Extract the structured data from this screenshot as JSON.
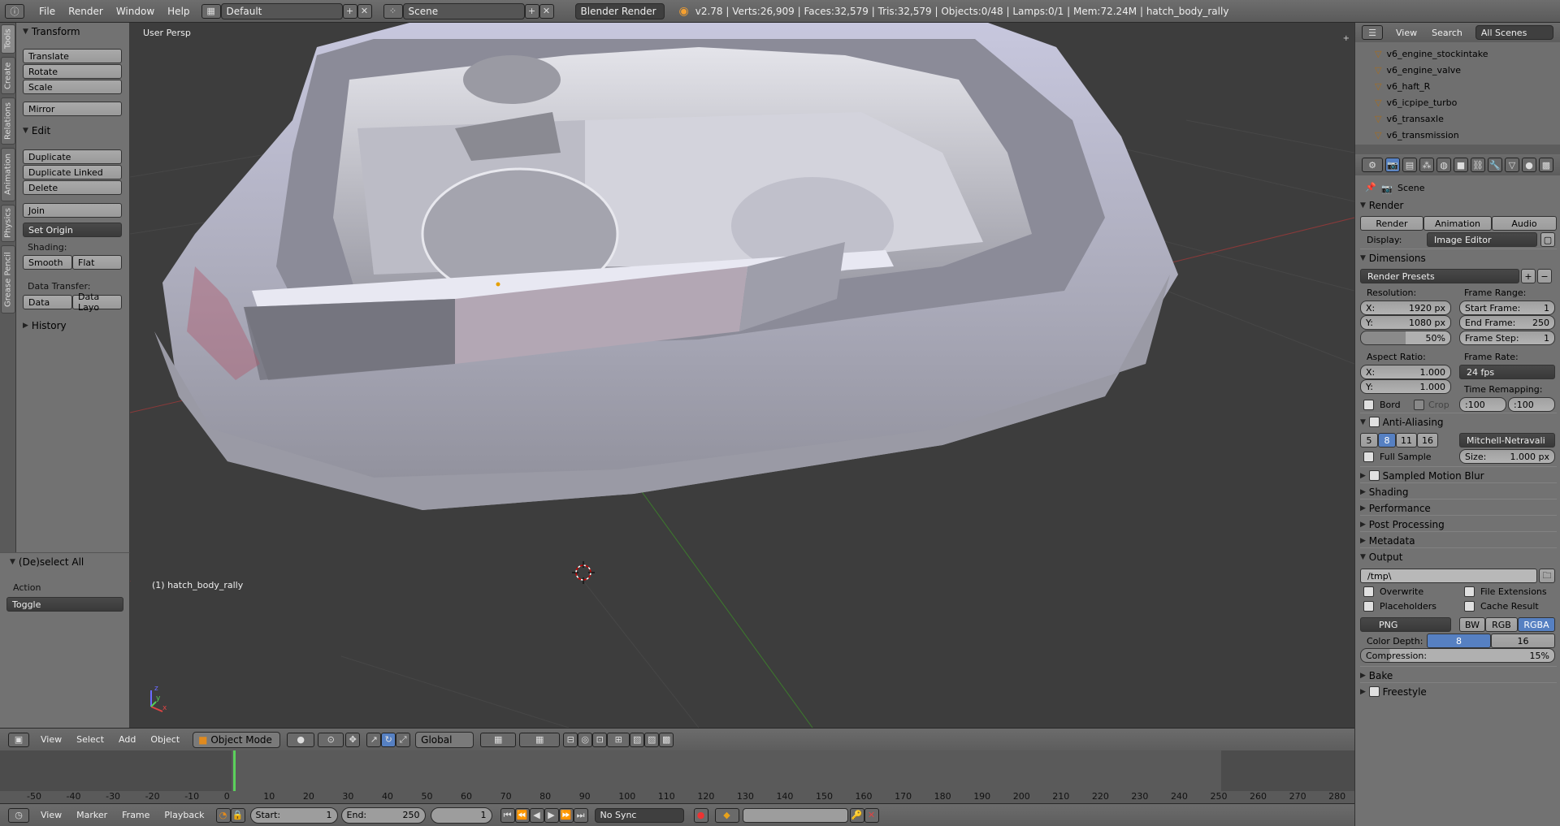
{
  "topbar": {
    "menus": [
      "File",
      "Render",
      "Window",
      "Help"
    ],
    "layout": "Default",
    "scene": "Scene",
    "engine": "Blender Render",
    "stats": "v2.78 | Verts:26,909 | Faces:32,579 | Tris:32,579 | Objects:0/48 | Lamps:0/1 | Mem:72.24M | hatch_body_rally"
  },
  "vtabs": [
    "Tools",
    "Create",
    "Relations",
    "Animation",
    "Physics",
    "Grease Pencil"
  ],
  "tools": {
    "transform_title": "Transform",
    "translate": "Translate",
    "rotate": "Rotate",
    "scale": "Scale",
    "mirror": "Mirror",
    "edit_title": "Edit",
    "duplicate": "Duplicate",
    "duplicate_linked": "Duplicate Linked",
    "delete": "Delete",
    "join": "Join",
    "set_origin": "Set Origin",
    "shading_label": "Shading:",
    "smooth": "Smooth",
    "flat": "Flat",
    "data_transfer_label": "Data Transfer:",
    "data": "Data",
    "data_layout": "Data Layo",
    "history_title": "History"
  },
  "operator": {
    "title": "(De)select All",
    "action_label": "Action",
    "action_value": "Toggle"
  },
  "viewport": {
    "view_name": "User Persp",
    "object_label": "(1) hatch_body_rally"
  },
  "outliner": {
    "menu_view": "View",
    "menu_search": "Search",
    "filter": "All Scenes",
    "items": [
      "v6_engine_stockintake",
      "v6_engine_valve",
      "v6_haft_R",
      "v6_icpipe_turbo",
      "v6_transaxle",
      "v6_transmission"
    ]
  },
  "props": {
    "scene": "Scene",
    "render_title": "Render",
    "render_btn": "Render",
    "animation_btn": "Animation",
    "audio_btn": "Audio",
    "display_label": "Display:",
    "display_value": "Image Editor",
    "dimensions_title": "Dimensions",
    "render_presets": "Render Presets",
    "resolution_label": "Resolution:",
    "res_x": "1920 px",
    "res_y": "1080 px",
    "res_pct": "50%",
    "frame_range_label": "Frame Range:",
    "start_frame": "1",
    "end_frame": "250",
    "frame_step": "1",
    "start_frame_label": "Start Frame:",
    "end_frame_label": "End Frame:",
    "frame_step_label": "Frame Step:",
    "aspect_label": "Aspect Ratio:",
    "aspect_x": "1.000",
    "aspect_y": "1.000",
    "frame_rate_label": "Frame Rate:",
    "frame_rate": "24 fps",
    "time_remap_label": "Time Remapping:",
    "remap_old": ":100",
    "remap_new": ":100",
    "bord": "Bord",
    "crop": "Crop",
    "aa_title": "Anti-Aliasing",
    "aa_samples": [
      "5",
      "8",
      "11",
      "16"
    ],
    "aa_filter": "Mitchell-Netravali",
    "full_sample": "Full Sample",
    "size_label": "Size:",
    "size_value": "1.000 px",
    "smb_title": "Sampled Motion Blur",
    "shading_title": "Shading",
    "performance_title": "Performance",
    "post_title": "Post Processing",
    "metadata_title": "Metadata",
    "output_title": "Output",
    "output_path": "/tmp\\",
    "overwrite": "Overwrite",
    "file_ext": "File Extensions",
    "placeholders": "Placeholders",
    "cache_result": "Cache Result",
    "format": "PNG",
    "bw": "BW",
    "rgb": "RGB",
    "rgba": "RGBA",
    "color_depth_label": "Color Depth:",
    "depth_8": "8",
    "depth_16": "16",
    "compression_label": "Compression:",
    "compression_value": "15%",
    "bake_title": "Bake",
    "freestyle_title": "Freestyle",
    "x_label": "X:",
    "y_label": "Y:"
  },
  "vpheader": {
    "menus": [
      "View",
      "Select",
      "Add",
      "Object"
    ],
    "mode": "Object Mode",
    "orientation": "Global"
  },
  "timeline": {
    "ticks": [
      "-50",
      "-40",
      "-30",
      "-20",
      "-10",
      "0",
      "10",
      "20",
      "30",
      "40",
      "50",
      "60",
      "70",
      "80",
      "90",
      "100",
      "110",
      "120",
      "130",
      "140",
      "150",
      "160",
      "170",
      "180",
      "190",
      "200",
      "210",
      "220",
      "230",
      "240",
      "250",
      "260",
      "270",
      "280"
    ],
    "current_frame": "1",
    "menus": [
      "View",
      "Marker",
      "Frame",
      "Playback"
    ],
    "start_label": "Start:",
    "start": "1",
    "end_label": "End:",
    "end": "250",
    "sync": "No Sync"
  }
}
